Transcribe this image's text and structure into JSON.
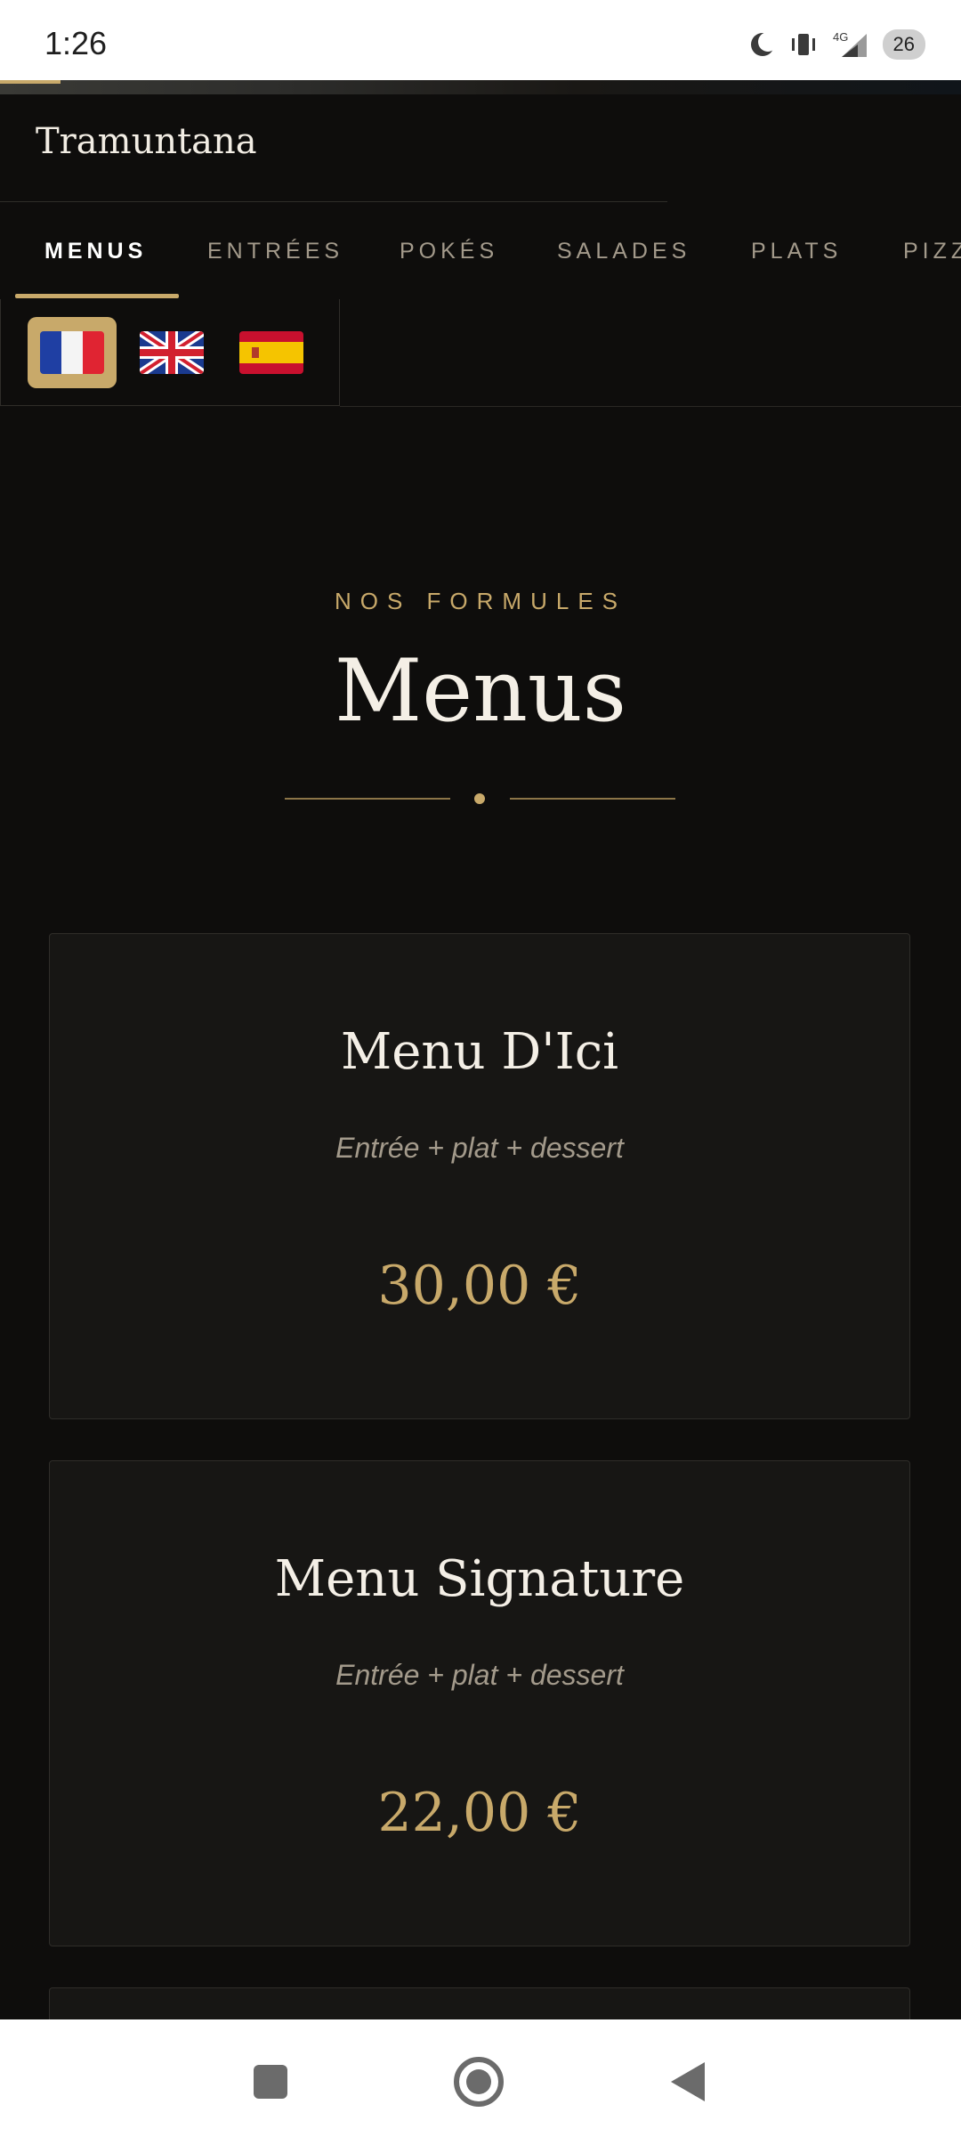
{
  "status": {
    "time": "1:26",
    "battery": "26",
    "network": "4G"
  },
  "brand": "Tramuntana",
  "tabs": [
    {
      "label": "MENUS",
      "active": true
    },
    {
      "label": "ENTRÉES"
    },
    {
      "label": "POKÉS"
    },
    {
      "label": "SALADES"
    },
    {
      "label": "PLATS"
    },
    {
      "label": "PIZZ"
    }
  ],
  "languages": [
    {
      "code": "fr",
      "icon": "flag-fr-icon",
      "active": true
    },
    {
      "code": "en",
      "icon": "flag-uk-icon"
    },
    {
      "code": "es",
      "icon": "flag-es-icon"
    }
  ],
  "section": {
    "subtitle": "NOS FORMULES",
    "title": "Menus"
  },
  "menus": [
    {
      "name": "Menu D'Ici",
      "desc": "Entrée + plat + dessert",
      "price": "30,00 €"
    },
    {
      "name": "Menu Signature",
      "desc": "Entrée + plat + dessert",
      "price": "22,00 €"
    }
  ],
  "colors": {
    "accent": "#c8a96a",
    "background": "#0e0d0c",
    "card": "#171614"
  }
}
